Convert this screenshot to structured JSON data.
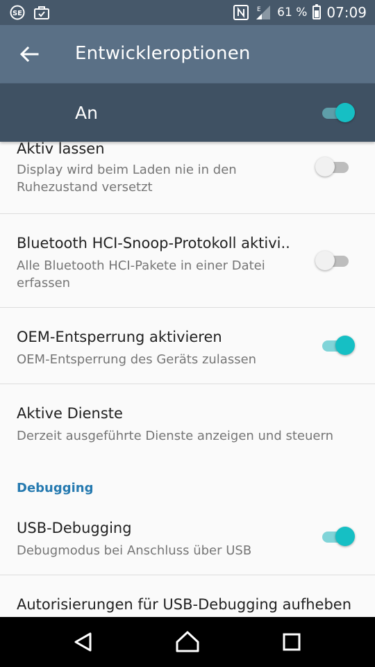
{
  "status_bar": {
    "left_icons": [
      "sony-select-icon",
      "shopping-bag-icon"
    ],
    "right_icons": [
      "nfc-icon",
      "signal-icon",
      "battery-icon"
    ],
    "battery_percent": "61 %",
    "battery_level": 0.61,
    "time": "07:09"
  },
  "app_bar": {
    "title": "Entwickleroptionen",
    "back_icon": "back-arrow-icon"
  },
  "master_switch": {
    "label": "An",
    "state": "on"
  },
  "items": [
    {
      "title": "Aktiv lassen",
      "summary": "Display wird beim Laden nie in den Ruhezustand versetzt",
      "switch": "off"
    },
    {
      "title": "Bluetooth HCI-Snoop-Protokoll aktivi..",
      "summary": "Alle Bluetooth HCI-Pakete in einer Datei erfassen",
      "switch": "off"
    },
    {
      "title": "OEM-Entsperrung aktivieren",
      "summary": "OEM-Entsperrung des Geräts zulassen",
      "switch": "on"
    },
    {
      "title": "Aktive Dienste",
      "summary": "Derzeit ausgeführte Dienste anzeigen und steuern"
    },
    {
      "title": "USB-Debugging",
      "summary": "Debugmodus bei Anschluss über USB",
      "switch": "on"
    },
    {
      "title": "Autorisierungen für USB-Debugging aufheben"
    }
  ],
  "category_debugging": "Debugging",
  "colors": {
    "accent": "#16bfc4",
    "category": "#267ab0",
    "app_bar": "#5a7086",
    "master_bar": "#3f5163"
  },
  "nav_bar": {
    "icons": [
      "back-triangle-icon",
      "home-icon",
      "recents-icon"
    ]
  }
}
